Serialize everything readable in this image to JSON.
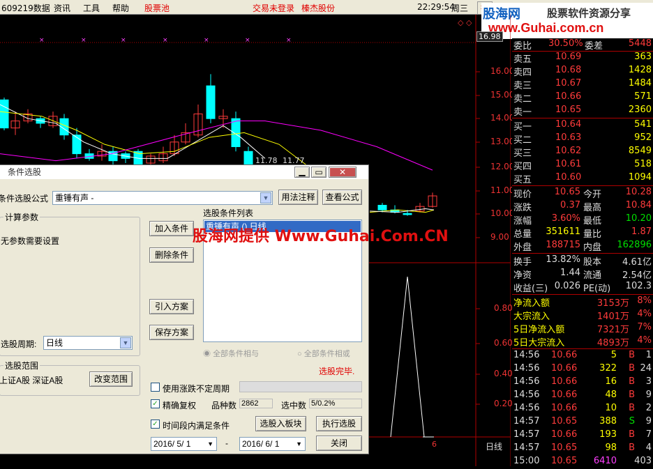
{
  "menu": {
    "code_data": "609219数据",
    "items": [
      "资讯",
      "工具",
      "帮助"
    ],
    "stock_pool": "股票池",
    "trade_status": "交易未登录",
    "stock_name": "榛杰股份",
    "time": "22:29:54",
    "weekday": "周三",
    "hang": "行",
    "qing": "情"
  },
  "watermark": {
    "logo": "股海网",
    "slogan": "股票软件资源分享",
    "url": "www.Guhai.com.cn",
    "center": "股海网提供 Www.Guhai.Com.CN"
  },
  "chart": {
    "price_labels": [
      "16.00",
      "15.00",
      "14.00",
      "13.00",
      "12.00",
      "11.00",
      "10.00",
      "9.00"
    ],
    "current_price_box": "16.98",
    "volume_labels": [
      "0.80",
      "0.60",
      "0.40",
      "0.20"
    ],
    "min_marks": [
      "11.78",
      "11.77"
    ],
    "period_label": "日线",
    "bottom_num": "6",
    "diamonds": "◇ ◇"
  },
  "quote": {
    "wei": {
      "label": "委比",
      "ratio": "30.50%",
      "diff_label": "委差",
      "diff": "5448"
    },
    "asks": [
      {
        "label": "卖五",
        "price": "10.69",
        "vol": "363"
      },
      {
        "label": "卖四",
        "price": "10.68",
        "vol": "1428"
      },
      {
        "label": "卖三",
        "price": "10.67",
        "vol": "1484"
      },
      {
        "label": "卖二",
        "price": "10.66",
        "vol": "571"
      },
      {
        "label": "卖一",
        "price": "10.65",
        "vol": "2360"
      }
    ],
    "bids": [
      {
        "label": "买一",
        "price": "10.64",
        "vol": "541"
      },
      {
        "label": "买二",
        "price": "10.63",
        "vol": "952"
      },
      {
        "label": "买三",
        "price": "10.62",
        "vol": "8549"
      },
      {
        "label": "买四",
        "price": "10.61",
        "vol": "518"
      },
      {
        "label": "买五",
        "price": "10.60",
        "vol": "1094"
      }
    ],
    "stats": [
      {
        "l1": "现价",
        "v1": "10.65",
        "l2": "今开",
        "v2": "10.28"
      },
      {
        "l1": "涨跌",
        "v1": "0.37",
        "l2": "最高",
        "v2": "10.84"
      },
      {
        "l1": "涨幅",
        "v1": "3.60%",
        "l2": "最低",
        "v2": "10.20"
      },
      {
        "l1": "总量",
        "v1": "351611",
        "l2": "量比",
        "v2": "1.87"
      },
      {
        "l1": "外盘",
        "v1": "188715",
        "l2": "内盘",
        "v2": "162896"
      }
    ],
    "stats2": [
      {
        "l1": "换手",
        "v1": "13.82%",
        "l2": "股本",
        "v2": "4.61亿"
      },
      {
        "l1": "净资",
        "v1": "1.44",
        "l2": "流通",
        "v2": "2.54亿"
      },
      {
        "l1": "收益(三)",
        "v1": "0.026",
        "l2": "PE(动)",
        "v2": "102.3"
      }
    ],
    "flows": [
      {
        "label": "净流入额",
        "val": "3153万",
        "pct": "8%"
      },
      {
        "label": "大宗流入",
        "val": "1401万",
        "pct": "4%"
      },
      {
        "label": "5日净流入额",
        "val": "7321万",
        "pct": "7%"
      },
      {
        "label": "5日大宗流入",
        "val": "4893万",
        "pct": "4%"
      }
    ],
    "ticks": [
      {
        "t": "14:56",
        "p": "10.66",
        "v": "5",
        "s": "B",
        "n": "1"
      },
      {
        "t": "14:56",
        "p": "10.66",
        "v": "322",
        "s": "B",
        "n": "24"
      },
      {
        "t": "14:56",
        "p": "10.66",
        "v": "16",
        "s": "B",
        "n": "3"
      },
      {
        "t": "14:56",
        "p": "10.66",
        "v": "48",
        "s": "B",
        "n": "9"
      },
      {
        "t": "14:56",
        "p": "10.66",
        "v": "10",
        "s": "B",
        "n": "2"
      },
      {
        "t": "14:57",
        "p": "10.65",
        "v": "388",
        "s": "S",
        "n": "9"
      },
      {
        "t": "14:57",
        "p": "10.66",
        "v": "193",
        "s": "B",
        "n": "7"
      },
      {
        "t": "14:57",
        "p": "10.65",
        "v": "98",
        "s": "B",
        "n": "4"
      },
      {
        "t": "15:00",
        "p": "10.65",
        "v": "6410",
        "s": "",
        "n": "403"
      }
    ]
  },
  "dialog": {
    "title": "条件选股",
    "formula_label": "条件选股公式",
    "formula_value": "重锤有声 -",
    "usage_btn": "用法注释",
    "view_btn": "查看公式",
    "calc_params": "计算参数",
    "no_params": "无参数需要设置",
    "list_label": "选股条件列表",
    "list_item": "重锤有声  () 日线",
    "add_btn": "加入条件",
    "del_btn": "删除条件",
    "import_btn": "引入方案",
    "save_btn": "保存方案",
    "period_label": "选股周期:",
    "period_value": "日线",
    "all_and": "全部条件相与",
    "all_or": "全部条件相或",
    "range_label": "选股范围",
    "range_value": "上证A股 深证A股",
    "change_range_btn": "改变范围",
    "done": "选股完毕.",
    "use_limit": "使用涨跌不定周期",
    "precise": "精确复权",
    "count_label": "品种数",
    "count_value": "2862",
    "selected_label": "选中数",
    "selected_value": "5/0.2%",
    "period_satisfy": "时间段内满足条件",
    "to_board_btn": "选股入板块",
    "run_btn": "执行选股",
    "date_from": "2016/ 5/ 1",
    "dash": "-",
    "date_to": "2016/ 6/ 1",
    "close_btn": "关闭"
  },
  "colors": {
    "up": "#ff3b3b",
    "down": "#00ffff",
    "ma5": "#ffffff",
    "ma10": "#ffff00",
    "ma30": "#ff00ff",
    "axis": "#b00000"
  }
}
